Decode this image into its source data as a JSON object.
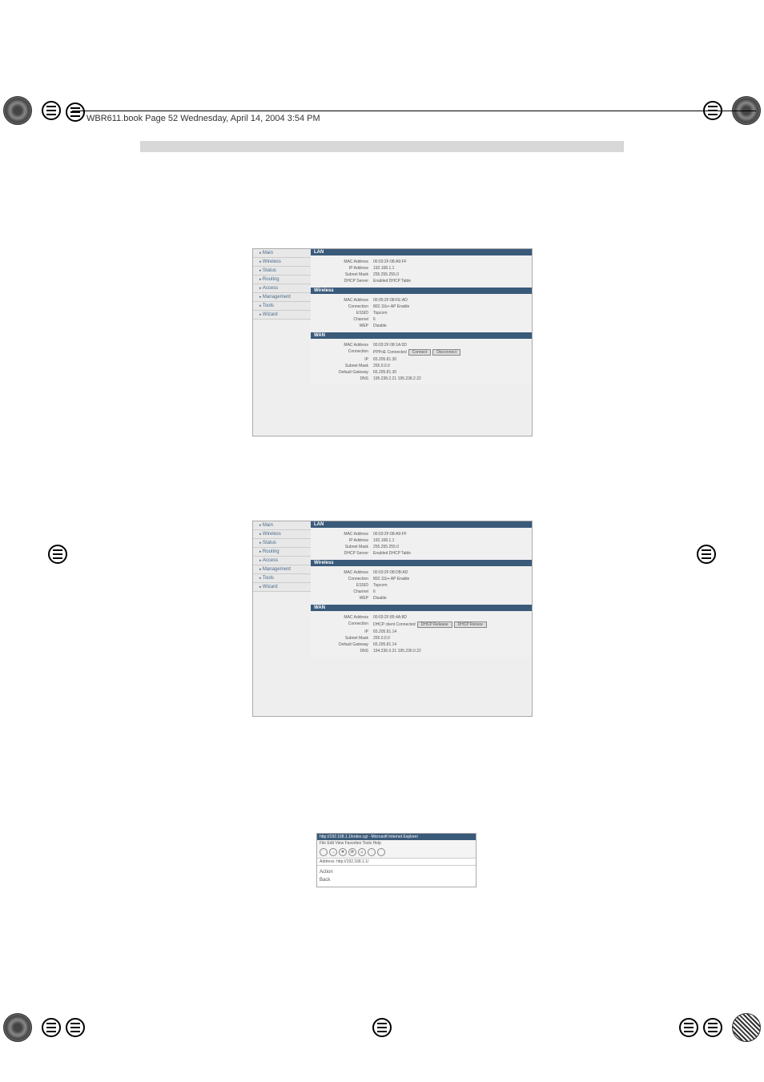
{
  "header": {
    "text": "WBR611.book  Page 52  Wednesday, April 14, 2004  3:54 PM"
  },
  "panel1": {
    "sidebar": [
      "Main",
      "Wireless",
      "Status",
      "Routing",
      "Access",
      "Management",
      "Tools",
      "Wizard"
    ],
    "lan": {
      "title": "LAN",
      "rows": [
        {
          "label": "MAC Address",
          "value": "00:03:2F:08:A9:FF"
        },
        {
          "label": "IP Address",
          "value": "192.168.1.1"
        },
        {
          "label": "Subnet Mask",
          "value": "255.255.255.0"
        },
        {
          "label": "DHCP Server",
          "value": "Enabled   DHCP Table"
        }
      ]
    },
    "wireless": {
      "title": "Wireless",
      "rows": [
        {
          "label": "MAC Address",
          "value": "00:05:2F:08:FE:AD"
        },
        {
          "label": "Connection",
          "value": "802.11b+ AP Enable"
        },
        {
          "label": "ESSID",
          "value": "Topcom"
        },
        {
          "label": "Channel",
          "value": "6"
        },
        {
          "label": "WEP",
          "value": "Disable"
        }
      ]
    },
    "wan": {
      "title": "WAN",
      "rows": [
        {
          "label": "MAC Address",
          "value": "00:03:2F:08:1A:0D"
        },
        {
          "label": "Connection",
          "value": "PPPoE Connected"
        },
        {
          "label": "IP",
          "value": "65.205.81.30"
        },
        {
          "label": "Subnet Mask",
          "value": "255.0.0.0"
        },
        {
          "label": "Default Gateway",
          "value": "65.205.81.30"
        },
        {
          "label": "DNS",
          "value": "195.238.2.21 195.238.2.22"
        }
      ],
      "buttons": [
        "Connect",
        "Disconnect"
      ]
    }
  },
  "panel2": {
    "sidebar": [
      "Main",
      "Wireless",
      "Status",
      "Routing",
      "Access",
      "Management",
      "Tools",
      "Wizard"
    ],
    "lan": {
      "title": "LAN",
      "rows": [
        {
          "label": "MAC Address",
          "value": "00:03:2F:08:A9:FF"
        },
        {
          "label": "IP Address",
          "value": "192.168.1.1"
        },
        {
          "label": "Subnet Mask",
          "value": "255.255.255.0"
        },
        {
          "label": "DHCP Server",
          "value": "Enabled   DHCP Table"
        }
      ]
    },
    "wireless": {
      "title": "Wireless",
      "rows": [
        {
          "label": "MAC Address",
          "value": "00:03:2F:08:DB:AD"
        },
        {
          "label": "Connection",
          "value": "802.11b+ AP Enable"
        },
        {
          "label": "ESSID",
          "value": "Topcom"
        },
        {
          "label": "Channel",
          "value": "6"
        },
        {
          "label": "WEP",
          "value": "Disable"
        }
      ]
    },
    "wan": {
      "title": "WAN",
      "rows": [
        {
          "label": "MAC Address",
          "value": "00:03:2F:85:4A:8D"
        },
        {
          "label": "Connection",
          "value": "DHCP client Connected"
        },
        {
          "label": "IP",
          "value": "65.205.81.14"
        },
        {
          "label": "Subnet Mask",
          "value": "255.0.0.0"
        },
        {
          "label": "Default Gateway",
          "value": "65.205.81.14"
        },
        {
          "label": "DNS",
          "value": "194.236.0.21 195.236.0.22"
        }
      ],
      "buttons": [
        "DHCP Release",
        "DHCP Renew"
      ]
    }
  },
  "browser": {
    "title": "http://192.168.1.1/index.cgi - Microsoft Internet Explorer",
    "menu": [
      "File",
      "Edit",
      "View",
      "Favorites",
      "Tools",
      "Help"
    ],
    "toolbar": [
      "Back",
      "→",
      "✕",
      "⟳",
      "⌂",
      "Search",
      "Favorites"
    ],
    "address": "Address: http://192.168.1.1/",
    "body": [
      "Action",
      "Back"
    ]
  }
}
